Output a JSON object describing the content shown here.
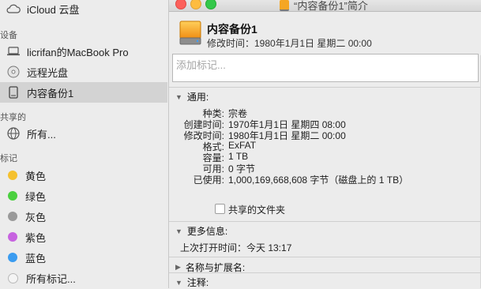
{
  "sidebar": {
    "icloud_label": "iCloud 云盘",
    "devices_header": "设备",
    "devices": [
      "licrifan的MacBook Pro",
      "远程光盘",
      "内容备份1"
    ],
    "shared_header": "共享的",
    "shared_item": "所有...",
    "tags_header": "标记",
    "tags": [
      {
        "label": "黄色",
        "color": "#f5c12e"
      },
      {
        "label": "绿色",
        "color": "#4ad03f"
      },
      {
        "label": "灰色",
        "color": "#9a9a9a"
      },
      {
        "label": "紫色",
        "color": "#c763e0"
      },
      {
        "label": "蓝色",
        "color": "#3b9cf0"
      }
    ],
    "all_tags": "所有标记..."
  },
  "window": {
    "title": "“内容备份1”简介",
    "name": "内容备份1",
    "modified_line": "修改时间：1980年1月1日 星期二 00:00",
    "tags_placeholder": "添加标记...",
    "general": {
      "header": "通用:",
      "rows": [
        {
          "k": "种类:",
          "v": "宗卷"
        },
        {
          "k": "创建时间:",
          "v": "1970年1月1日 星期四 08:00"
        },
        {
          "k": "修改时间:",
          "v": "1980年1月1日 星期二 00:00"
        },
        {
          "k": "格式:",
          "v": "ExFAT"
        },
        {
          "k": "容量:",
          "v": "1 TB"
        },
        {
          "k": "可用:",
          "v": "0 字节"
        },
        {
          "k": "已使用:",
          "v": "1,000,169,668,608 字节（磁盘上的 1 TB）"
        }
      ],
      "shared_folder": "共享的文件夹"
    },
    "more_info": {
      "header": "更多信息:",
      "last_opened": "上次打开时间：今天 13:17"
    },
    "name_ext_header": "名称与扩展名:",
    "notes_header": "注释:"
  }
}
